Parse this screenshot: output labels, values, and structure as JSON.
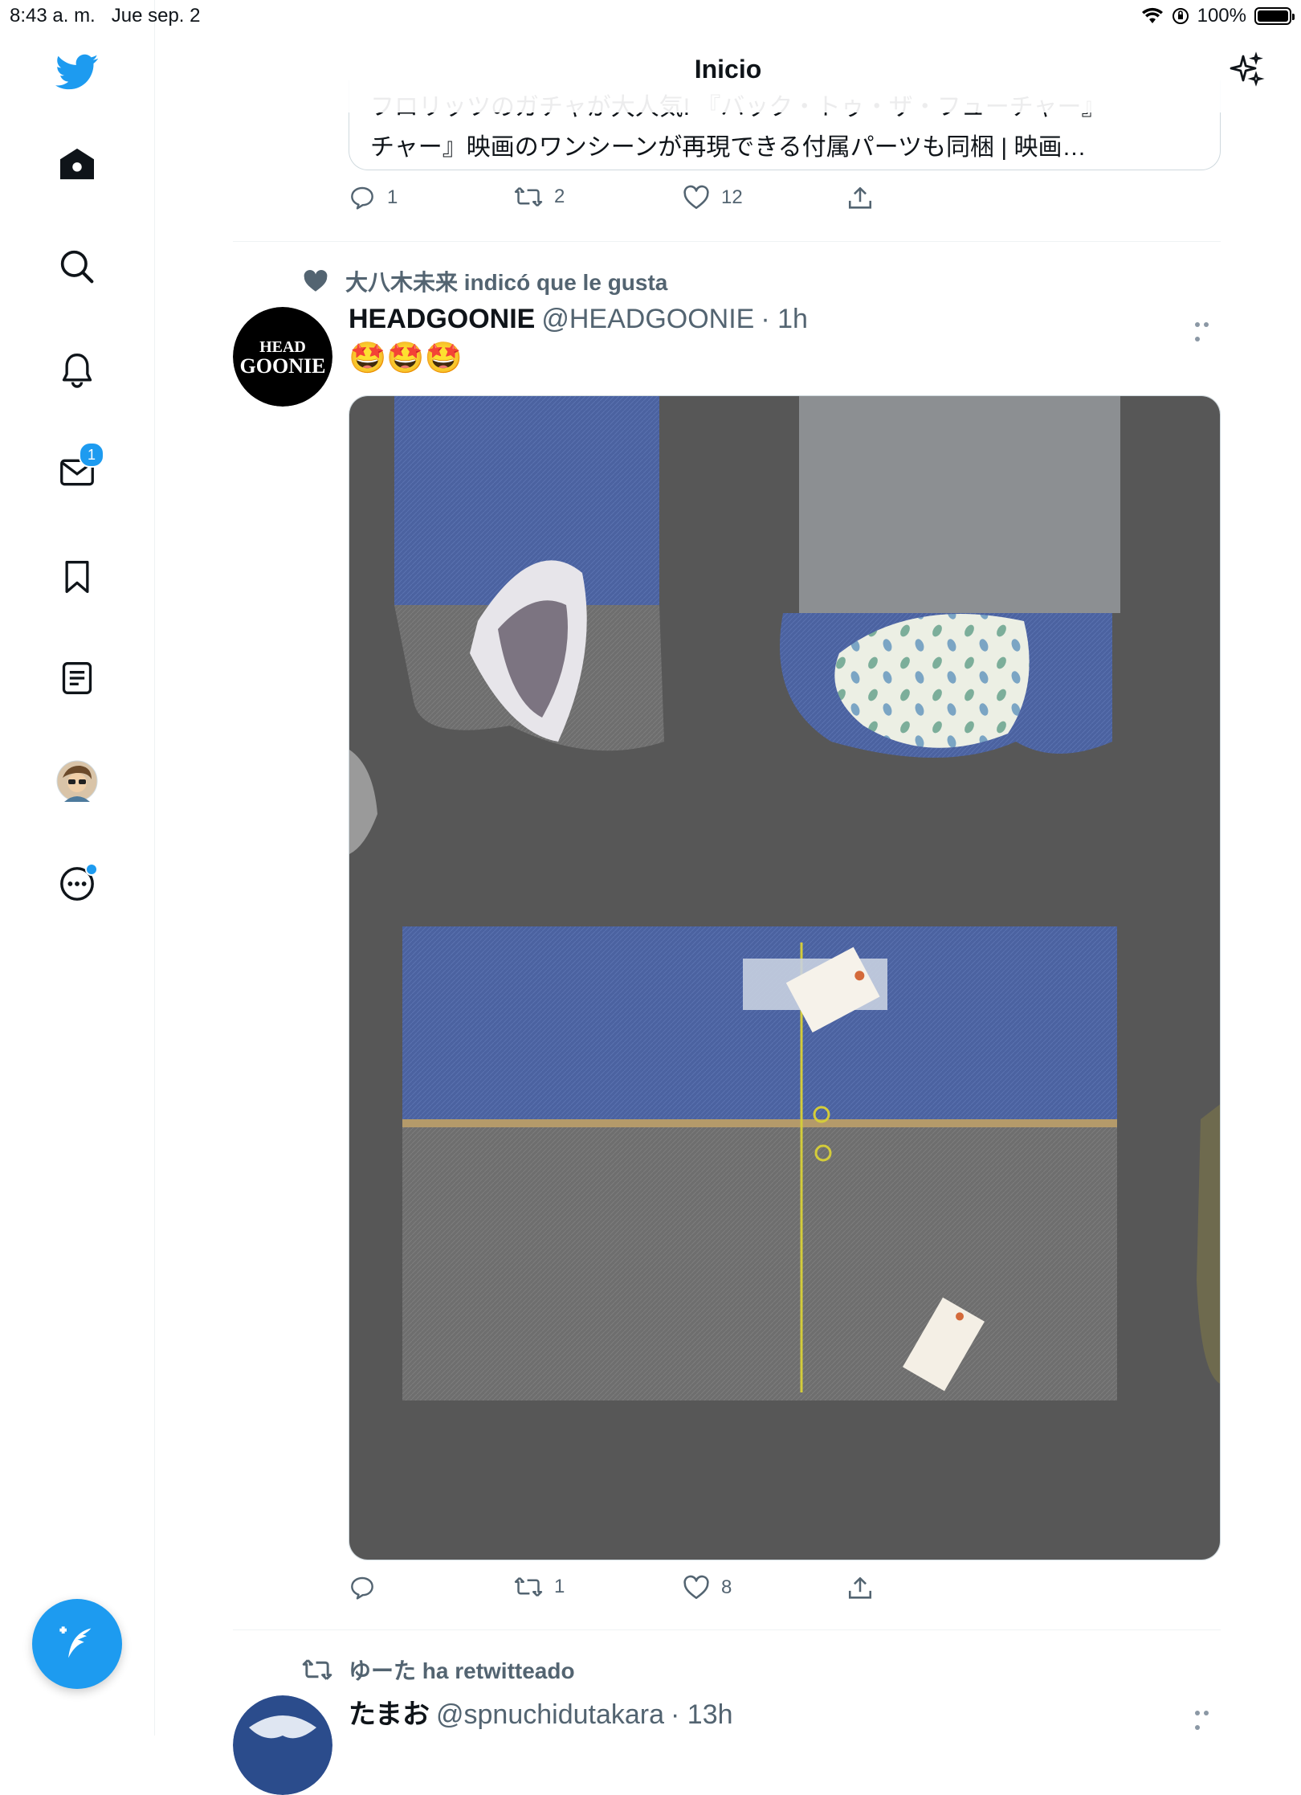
{
  "status_bar": {
    "time": "8:43 a. m.",
    "date": "Jue sep. 2",
    "battery": "100%",
    "battery_level": 1.0
  },
  "header": {
    "title": "Inicio"
  },
  "sidebar": {
    "items": [
      {
        "icon": "home-icon"
      },
      {
        "icon": "search-icon"
      },
      {
        "icon": "notifications-icon"
      },
      {
        "icon": "messages-icon",
        "badge": "1"
      },
      {
        "icon": "bookmark-icon"
      },
      {
        "icon": "lists-icon"
      },
      {
        "icon": "profile-avatar"
      },
      {
        "icon": "more-icon"
      }
    ]
  },
  "prev_tweet": {
    "card_line1": "フロリッツのガチャが大人気! 『バック・トゥ・ザ・フューチャー』",
    "card_line2": "チャー』映画のワンシーンが再現できる付属パーツも同梱 | 映画…",
    "replies": "1",
    "retweets": "2",
    "likes": "12"
  },
  "tweet": {
    "social_context": "大八木未来 indicó que le gusta",
    "avatar_text_top": "HEAD",
    "avatar_text_bottom": "GOONIE",
    "name": "HEADGOONIE",
    "handle": "@HEADGOONIE",
    "time": "· 1h",
    "text": "🤩🤩🤩",
    "replies": "",
    "retweets": "1",
    "likes": "8"
  },
  "next_tweet": {
    "social_context": "ゆーた ha retwitteado",
    "name": "たまお",
    "handle": "@spnuchidutakara",
    "time": "· 13h"
  },
  "colors": {
    "accent": "#1d9bf0",
    "muted": "#536471"
  }
}
